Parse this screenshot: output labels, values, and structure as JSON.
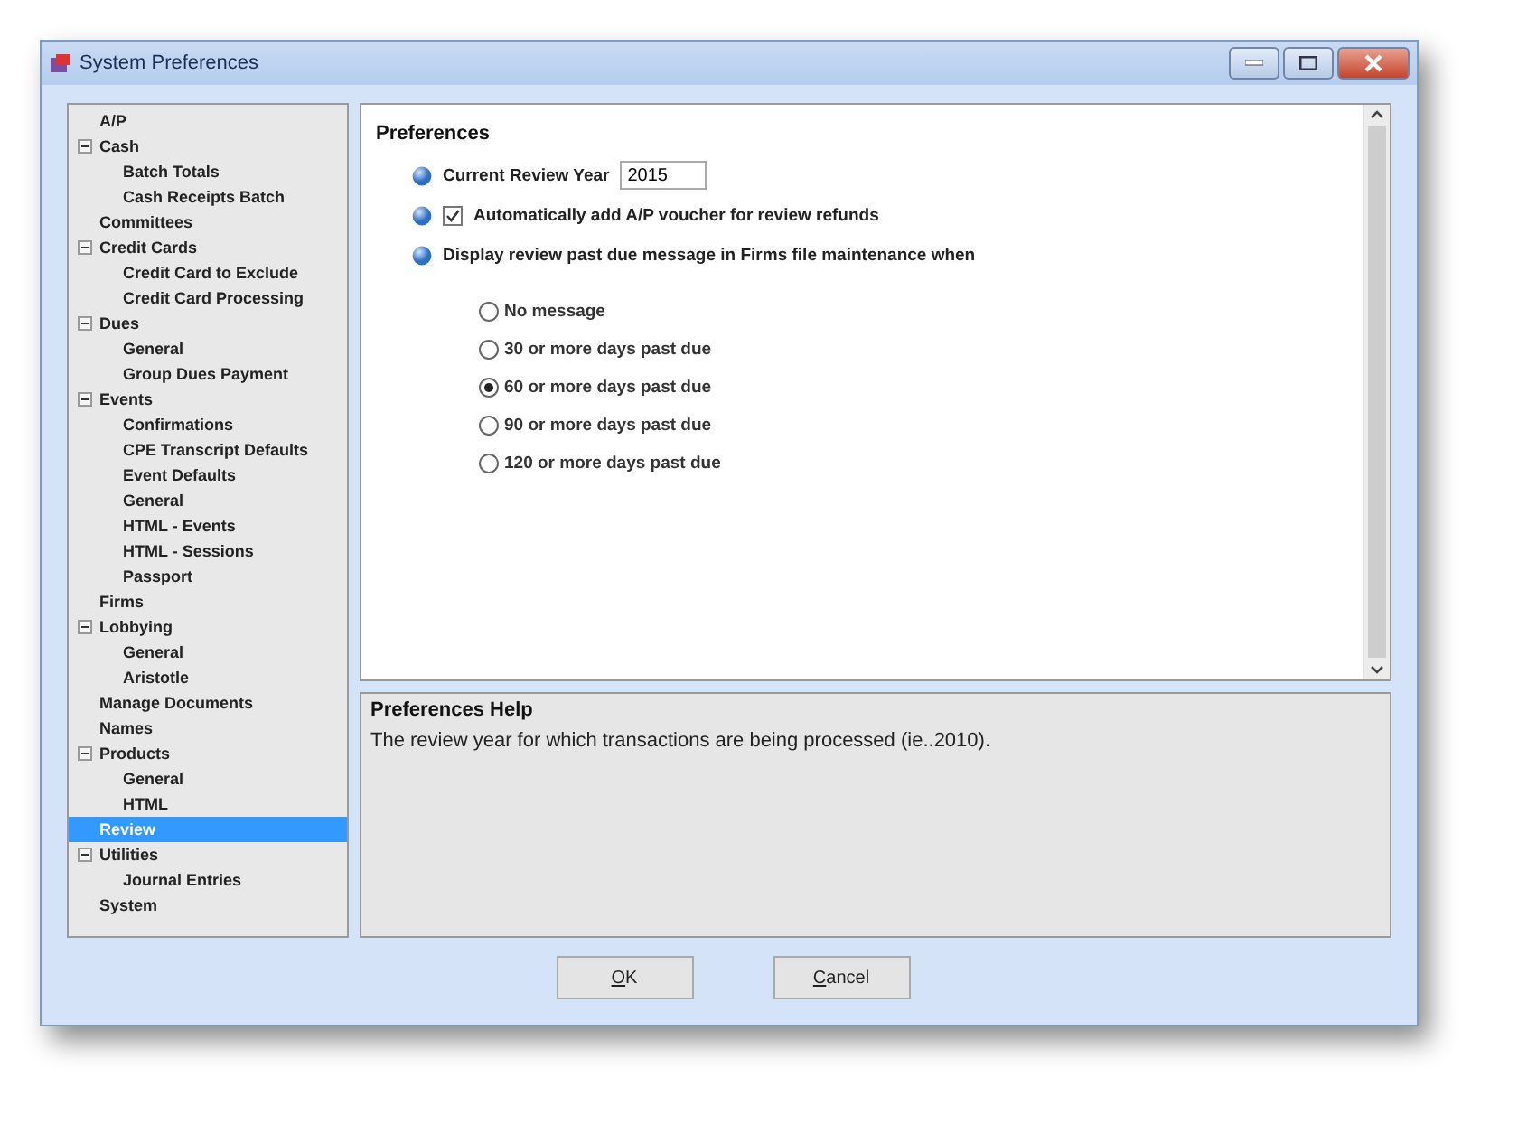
{
  "window": {
    "title": "System Preferences"
  },
  "tree": [
    {
      "label": "A/P",
      "selected": false
    },
    {
      "label": "Cash",
      "selected": false,
      "expanded": true,
      "children": [
        {
          "label": "Batch Totals",
          "selected": false
        },
        {
          "label": "Cash Receipts Batch",
          "selected": false
        }
      ]
    },
    {
      "label": "Committees",
      "selected": false
    },
    {
      "label": "Credit Cards",
      "selected": false,
      "expanded": true,
      "children": [
        {
          "label": "Credit Card to Exclude",
          "selected": false
        },
        {
          "label": "Credit Card Processing",
          "selected": false
        }
      ]
    },
    {
      "label": "Dues",
      "selected": false,
      "expanded": true,
      "children": [
        {
          "label": "General",
          "selected": false
        },
        {
          "label": "Group Dues Payment",
          "selected": false
        }
      ]
    },
    {
      "label": "Events",
      "selected": false,
      "expanded": true,
      "children": [
        {
          "label": "Confirmations",
          "selected": false
        },
        {
          "label": "CPE Transcript Defaults",
          "selected": false
        },
        {
          "label": "Event Defaults",
          "selected": false
        },
        {
          "label": "General",
          "selected": false
        },
        {
          "label": "HTML - Events",
          "selected": false
        },
        {
          "label": "HTML - Sessions",
          "selected": false
        },
        {
          "label": "Passport",
          "selected": false
        }
      ]
    },
    {
      "label": "Firms",
      "selected": false
    },
    {
      "label": "Lobbying",
      "selected": false,
      "expanded": true,
      "children": [
        {
          "label": "General",
          "selected": false
        },
        {
          "label": "Aristotle",
          "selected": false
        }
      ]
    },
    {
      "label": "Manage Documents",
      "selected": false
    },
    {
      "label": "Names",
      "selected": false
    },
    {
      "label": "Products",
      "selected": false,
      "expanded": true,
      "children": [
        {
          "label": "General",
          "selected": false
        },
        {
          "label": "HTML",
          "selected": false
        }
      ]
    },
    {
      "label": "Review",
      "selected": true
    },
    {
      "label": "Utilities",
      "selected": false,
      "expanded": true,
      "children": [
        {
          "label": "Journal Entries",
          "selected": false
        }
      ]
    },
    {
      "label": "System",
      "selected": false
    }
  ],
  "preferences": {
    "title": "Preferences",
    "year": {
      "label": "Current Review Year",
      "value": "2015"
    },
    "voucher": {
      "label": "Automatically add A/P voucher for review refunds",
      "checked": true
    },
    "past_due": {
      "label": "Display review past due message in Firms file maintenance when",
      "options": [
        {
          "label": "No message",
          "selected": false
        },
        {
          "label": "30 or more days past due",
          "selected": false
        },
        {
          "label": "60 or more days past due",
          "selected": true
        },
        {
          "label": "90 or more days past due",
          "selected": false
        },
        {
          "label": "120 or more days past due",
          "selected": false
        }
      ]
    }
  },
  "help": {
    "title": "Preferences Help",
    "text": "The review year for which transactions are being processed (ie..2010)."
  },
  "buttons": [
    {
      "label": "OK",
      "mnemonic_underlined": true
    },
    {
      "label": "Cancel",
      "mnemonic_underlined": true
    }
  ]
}
